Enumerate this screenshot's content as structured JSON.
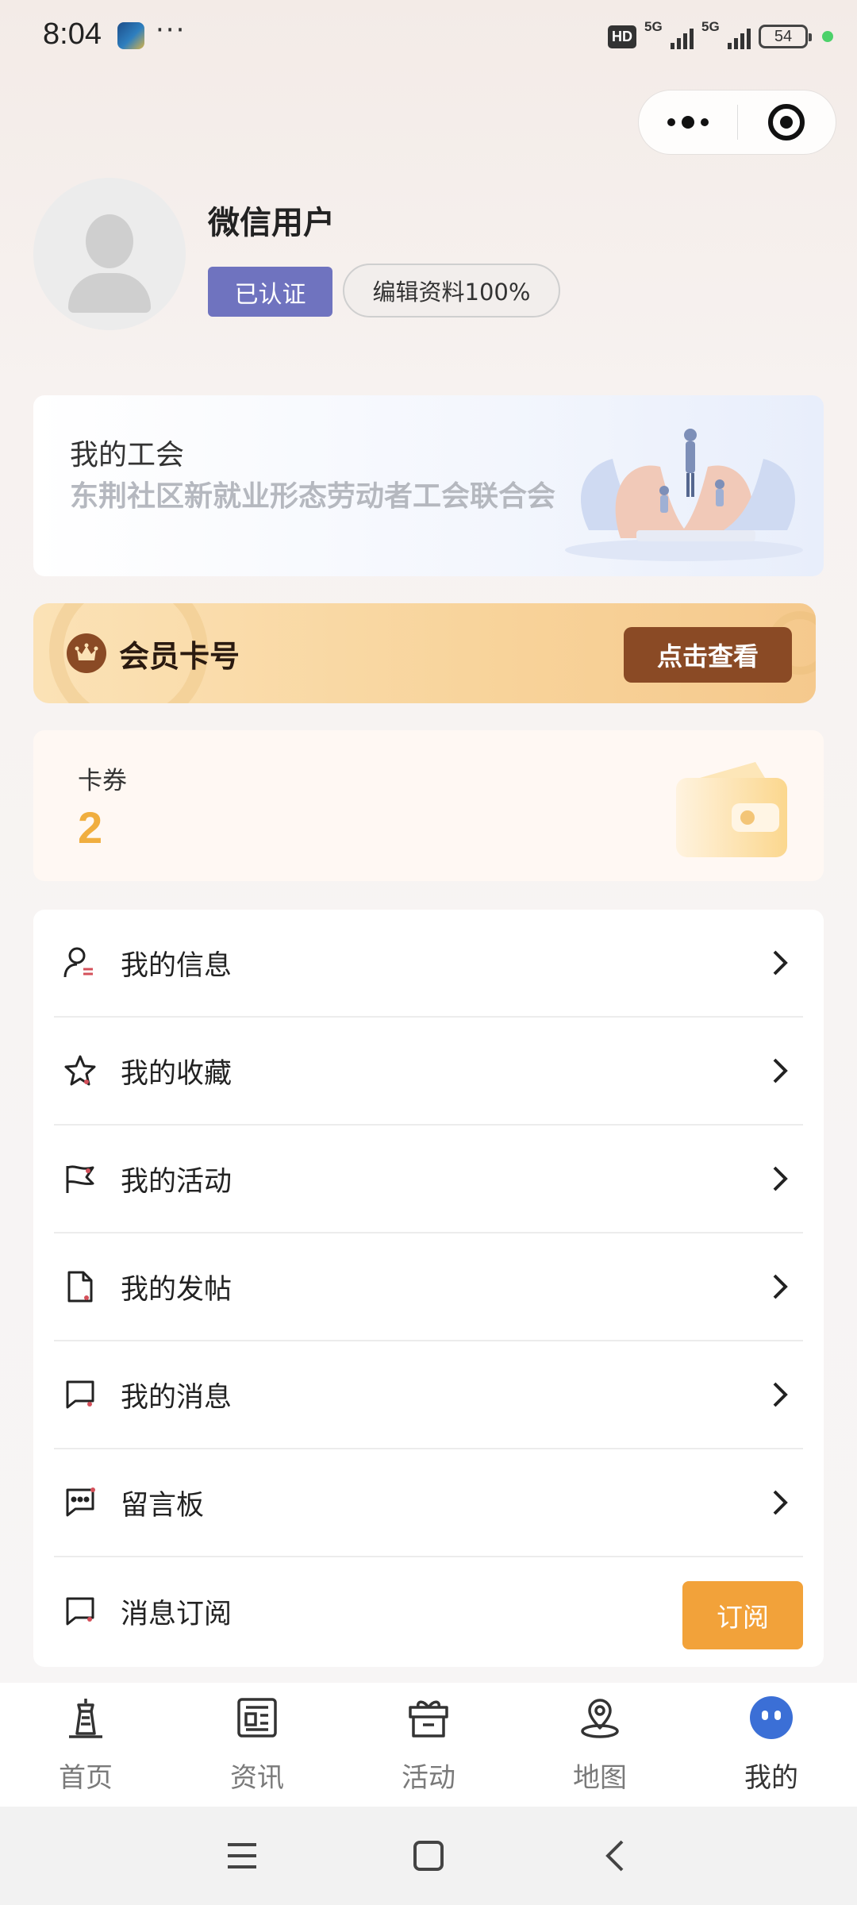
{
  "status_bar": {
    "time": "8:04",
    "more": "···",
    "hd": "HD",
    "network_1": "5G",
    "network_2": "5G",
    "battery": "54"
  },
  "profile": {
    "name": "微信用户",
    "verified_label": "已认证",
    "edit_label": "编辑资料100%"
  },
  "union": {
    "title": "我的工会",
    "name": "东荆社区新就业形态劳动者工会联合会"
  },
  "member_card": {
    "title": "会员卡号",
    "button": "点击查看"
  },
  "coupon": {
    "label": "卡券",
    "count": "2"
  },
  "menu": {
    "items": [
      {
        "label": "我的信息",
        "icon": "user-info-icon"
      },
      {
        "label": "我的收藏",
        "icon": "star-icon"
      },
      {
        "label": "我的活动",
        "icon": "flag-icon"
      },
      {
        "label": "我的发帖",
        "icon": "document-icon"
      },
      {
        "label": "我的消息",
        "icon": "message-icon"
      },
      {
        "label": "留言板",
        "icon": "comment-icon"
      },
      {
        "label": "消息订阅",
        "icon": "subscribe-icon"
      }
    ],
    "subscribe_button": "订阅"
  },
  "tabs": [
    {
      "label": "首页",
      "icon": "home-tower-icon",
      "active": false
    },
    {
      "label": "资讯",
      "icon": "news-icon",
      "active": false
    },
    {
      "label": "活动",
      "icon": "gift-icon",
      "active": false
    },
    {
      "label": "地图",
      "icon": "map-pin-icon",
      "active": false
    },
    {
      "label": "我的",
      "icon": "me-icon",
      "active": true
    }
  ],
  "colors": {
    "accent_purple": "#6f73bf",
    "member_brown": "#8a4a25",
    "coupon_gold": "#f0ae3f",
    "subscribe_orange": "#f2a23a",
    "tab_active_blue": "#3b6fd6"
  }
}
